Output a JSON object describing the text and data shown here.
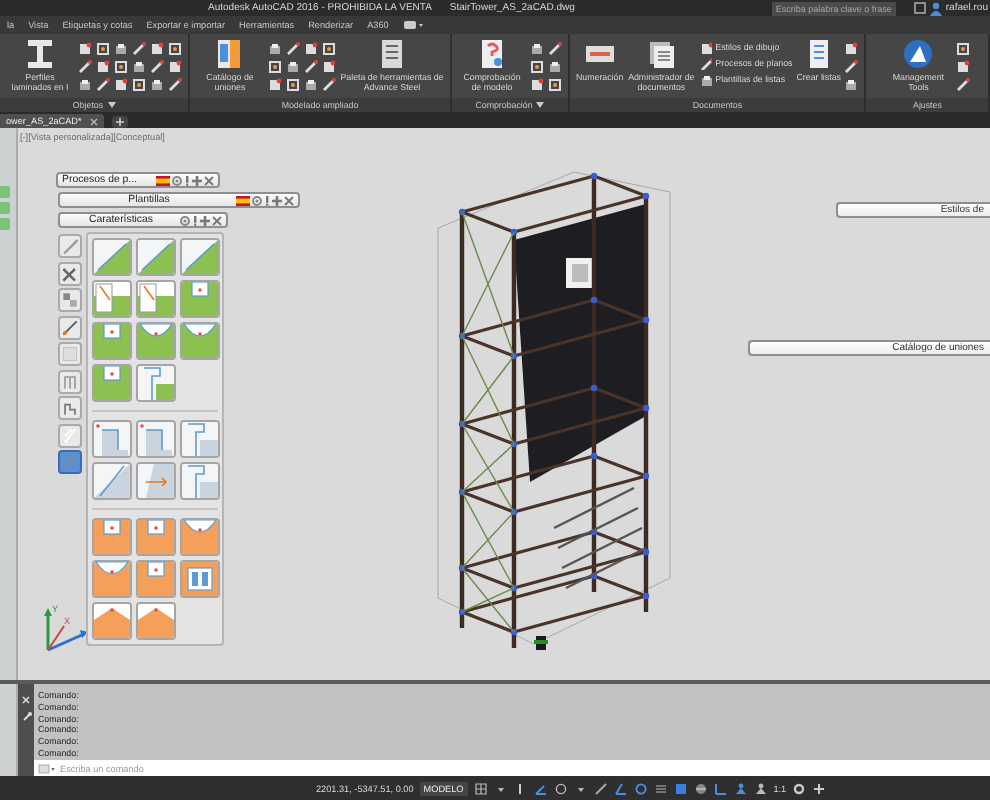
{
  "window": {
    "title": "Autodesk AutoCAD 2016 - PROHIBIDA LA VENTA",
    "file": "StairTower_AS_2aCAD.dwg"
  },
  "search": {
    "placeholder": "Escriba palabra clave o frase"
  },
  "user": "rafael.rou",
  "menu_tabs": [
    {
      "label": "la",
      "selected": false
    },
    {
      "label": "Vista",
      "selected": false
    },
    {
      "label": "Etiquetas y cotas",
      "selected": false
    },
    {
      "label": "Exportar e importar",
      "selected": false
    },
    {
      "label": "Herramientas",
      "selected": false
    },
    {
      "label": "Renderizar",
      "selected": false
    },
    {
      "label": "A360",
      "selected": false
    }
  ],
  "ribbon_panels": [
    {
      "title": "Objetos",
      "menu": true,
      "tools": [
        {
          "kind": "large",
          "label": "Perfiles laminados en I"
        },
        {
          "kind": "column"
        },
        {
          "kind": "column"
        },
        {
          "kind": "column"
        },
        {
          "kind": "column"
        },
        {
          "kind": "column"
        },
        {
          "kind": "column"
        }
      ]
    },
    {
      "title": "Modelado ampliado",
      "menu": false,
      "tools": [
        {
          "kind": "large",
          "label": "Catálogo de uniones"
        },
        {
          "kind": "column"
        },
        {
          "kind": "column"
        },
        {
          "kind": "column"
        },
        {
          "kind": "column"
        },
        {
          "kind": "large",
          "label": "Paleta de herramientas de Advance Steel"
        }
      ]
    },
    {
      "title": "Comprobación",
      "menu": true,
      "tools": [
        {
          "kind": "large",
          "label": "Comprobación de modelo"
        },
        {
          "kind": "column"
        },
        {
          "kind": "column"
        }
      ]
    },
    {
      "title": "Documentos",
      "menu": false,
      "tools": [
        {
          "kind": "large",
          "label": "Numeración"
        },
        {
          "kind": "large",
          "label": "Administrador de documentos"
        },
        {
          "kind": "list",
          "items": [
            "Estilos de dibujo",
            "Procesos de planos",
            "Plantillas de listas"
          ]
        },
        {
          "kind": "large",
          "label": "Crear listas"
        },
        {
          "kind": "column"
        }
      ]
    },
    {
      "title": "Ajustes",
      "menu": false,
      "tools": [
        {
          "kind": "large",
          "label": "Management Tools"
        },
        {
          "kind": "column"
        }
      ]
    }
  ],
  "file_tabs": [
    {
      "label": "ower_AS_2aCAD*",
      "selected": true
    }
  ],
  "viewport": {
    "label": "[-][Vista personalizada][Conceptual]",
    "floating_buttons": [
      "Estilos de",
      "Catálogo de uniones"
    ],
    "ucs": {
      "x": "X",
      "y": "Y"
    }
  },
  "palette": {
    "bars": [
      {
        "title": "Procesos de p...",
        "flag": true
      },
      {
        "title": "Plantillas",
        "flag": true
      },
      {
        "title": "Caraterísticas",
        "flag": false
      }
    ],
    "tools": [
      {
        "selected": false
      },
      {
        "selected": false
      },
      {
        "selected": false
      },
      {
        "selected": false
      },
      {
        "selected": false
      },
      {
        "selected": false
      },
      {
        "selected": false
      },
      {
        "selected": false
      },
      {
        "selected": true
      }
    ],
    "groups": [
      {
        "color": "#8cc152",
        "tiles": [
          {
            "kind": "slope"
          },
          {
            "kind": "slope"
          },
          {
            "kind": "slope"
          },
          {
            "kind": "plate"
          },
          {
            "kind": "plate"
          },
          {
            "kind": "notch"
          },
          {
            "kind": "notch"
          },
          {
            "kind": "arc"
          },
          {
            "kind": "arc"
          },
          {
            "kind": "notch"
          },
          {
            "kind": "stair"
          }
        ]
      },
      {
        "color": "#c9d4de",
        "tiles": [
          {
            "kind": "step"
          },
          {
            "kind": "step"
          },
          {
            "kind": "stair"
          },
          {
            "kind": "diagonal"
          },
          {
            "kind": "arrow"
          },
          {
            "kind": "stair"
          }
        ]
      },
      {
        "color": "#f5a05a",
        "tiles": [
          {
            "kind": "notch"
          },
          {
            "kind": "notch"
          },
          {
            "kind": "arc"
          },
          {
            "kind": "arc"
          },
          {
            "kind": "notch"
          },
          {
            "kind": "double"
          },
          {
            "kind": "roof"
          },
          {
            "kind": "roof"
          }
        ]
      }
    ]
  },
  "command": {
    "history": [
      "Comando:",
      "Comando:",
      "Comando:",
      "Comando:",
      "Comando:",
      "Comando:"
    ],
    "placeholder": "Escriba un comando"
  },
  "status": {
    "coordinates": "2201.31, -5347.51, 0.00",
    "mode": "MODELO",
    "scale": "1:1"
  }
}
